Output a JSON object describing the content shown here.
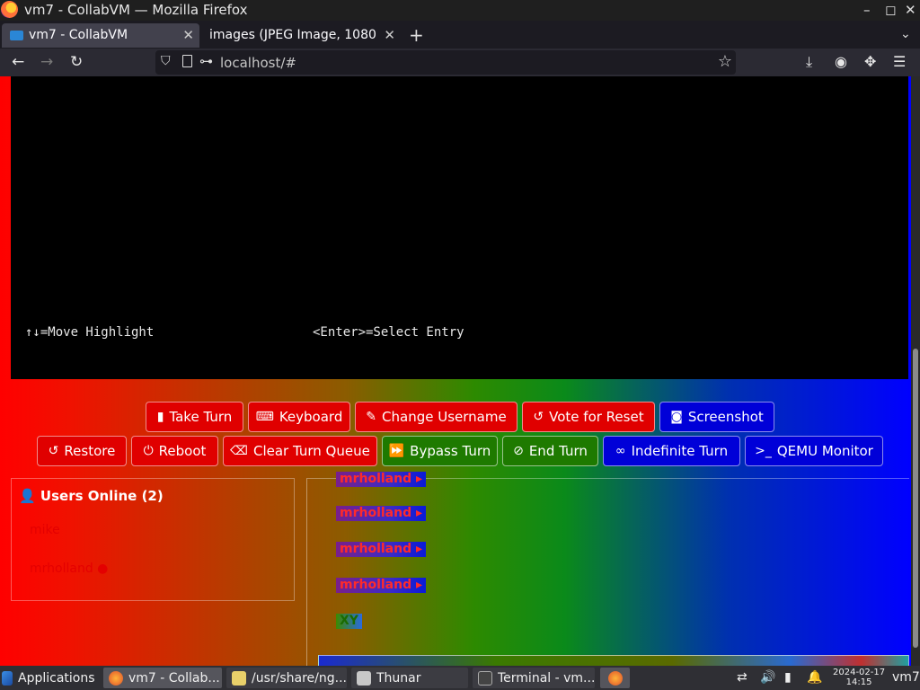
{
  "window": {
    "title": "vm7 - CollabVM — Mozilla Firefox",
    "controls": [
      "–",
      "◻",
      "✕"
    ]
  },
  "tabs": [
    {
      "label": "vm7 - CollabVM",
      "active": true
    },
    {
      "label": "images (JPEG Image, 1080 ×",
      "active": false
    }
  ],
  "navbar": {
    "url": "localhost/#",
    "back": "←",
    "forward": "→",
    "reload": "↻",
    "star": "☆"
  },
  "console": {
    "left": "↑↓=Move Highlight",
    "right": "<Enter>=Select Entry"
  },
  "vm_buttons_row1": [
    {
      "label": "Take Turn",
      "icon": "mouse-icon"
    },
    {
      "label": "Keyboard",
      "icon": "keyboard-icon"
    },
    {
      "label": "Change Username",
      "icon": "user-edit-icon"
    },
    {
      "label": "Vote for Reset",
      "icon": "reset-icon"
    },
    {
      "label": "Screenshot",
      "icon": "camera-icon"
    }
  ],
  "vm_buttons_row2": [
    {
      "label": "Restore",
      "icon": "restore-icon"
    },
    {
      "label": "Reboot",
      "icon": "power-icon"
    },
    {
      "label": "Clear Turn Queue",
      "icon": "eraser-icon"
    },
    {
      "label": "Bypass Turn",
      "icon": "forward-icon"
    },
    {
      "label": "End Turn",
      "icon": "ban-icon"
    },
    {
      "label": "Indefinite Turn",
      "icon": "infinity-icon"
    },
    {
      "label": "QEMU Monitor",
      "icon": "terminal-icon"
    }
  ],
  "users": {
    "title": "Users Online",
    "count": "(2)",
    "list": [
      "mike",
      "mrholland ●"
    ]
  },
  "chat": {
    "lines": [
      "mrholland ▸",
      "mrholland ▸",
      "mrholland ▸",
      "mrholland ▸",
      "XY"
    ]
  },
  "taskbar": {
    "applications": "Applications",
    "windows": [
      "vm7 - Collab...",
      "/usr/share/ng...",
      "Thunar",
      "Terminal - vm..."
    ],
    "clock_date": "2024-02-17",
    "clock_time": "14:15",
    "host": "vm7"
  },
  "colors": {
    "vm_red": "#e00000",
    "vm_blue": "#0000d8",
    "vm_green": "#1e7a00"
  }
}
